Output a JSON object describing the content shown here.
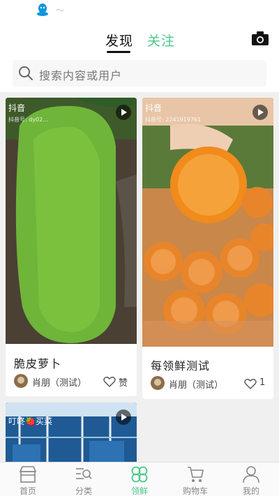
{
  "status_bar": {
    "glyph": "〜"
  },
  "header": {
    "tabs": [
      {
        "label": "发现",
        "active": true
      },
      {
        "label": "关注",
        "active": false
      }
    ]
  },
  "search": {
    "placeholder": "搜索内容或用户"
  },
  "feed": {
    "cards": [
      {
        "title": "脆皮萝卜",
        "author": "肖朋（测试）",
        "like_label": "赞",
        "watermark": "抖音",
        "watermark_id": "抖音号: dy02..."
      },
      {
        "title": "每领鲜测试",
        "author": "肖朋（测试）",
        "like_label": "1",
        "watermark": "抖音",
        "watermark_id": "抖音号: 2241919761"
      },
      {
        "overlay_text": "叮咚🍓买菜"
      }
    ]
  },
  "nav": {
    "items": [
      {
        "label": "首页",
        "icon": "store-icon"
      },
      {
        "label": "分类",
        "icon": "category-icon"
      },
      {
        "label": "领鲜",
        "icon": "clover-icon",
        "active": true
      },
      {
        "label": "购物车",
        "icon": "cart-icon"
      },
      {
        "label": "我的",
        "icon": "user-icon"
      }
    ]
  },
  "colors": {
    "accent": "#4cc68a",
    "qq_blue": "#1296db"
  }
}
